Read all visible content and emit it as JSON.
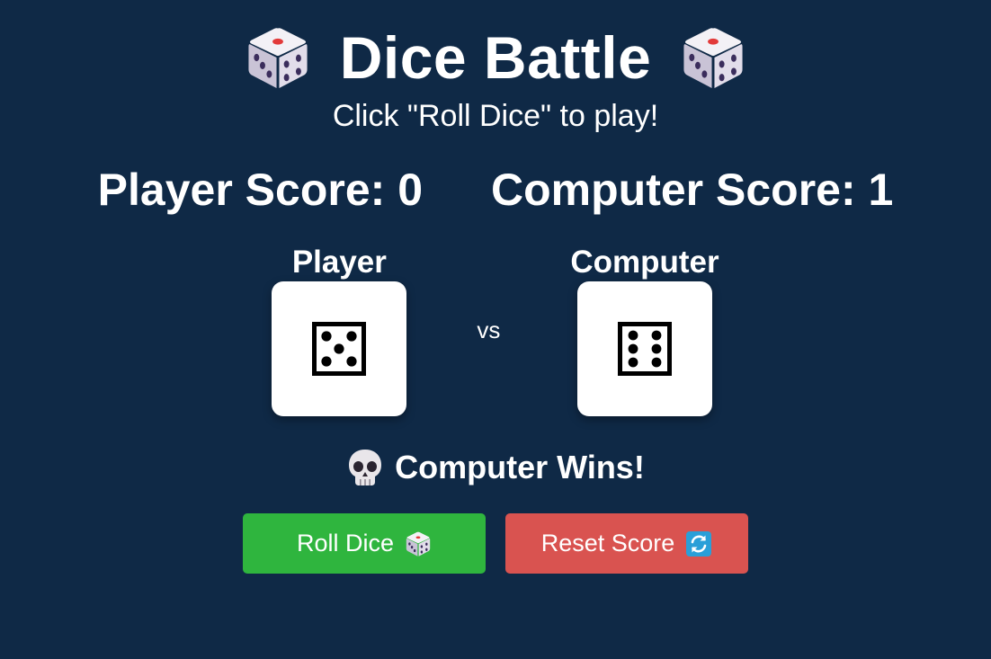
{
  "header": {
    "title": "Dice Battle",
    "subtitle": "Click \"Roll Dice\" to play!",
    "title_icon": "game-die-icon"
  },
  "scoreboard": {
    "player_label": "Player Score: 0",
    "player_score": 0,
    "computer_label": "Computer Score: 1",
    "computer_score": 1
  },
  "arena": {
    "player": {
      "label": "Player",
      "die_value": 5,
      "die_icon": "die-face-5-icon"
    },
    "vs_label": "vs",
    "computer": {
      "label": "Computer",
      "die_value": 6,
      "die_icon": "die-face-6-icon"
    }
  },
  "result": {
    "icon": "skull-icon",
    "text": "Computer Wins!"
  },
  "buttons": {
    "roll": {
      "label": "Roll Dice",
      "icon": "game-die-icon",
      "color": "#2fb53e"
    },
    "reset": {
      "label": "Reset Score",
      "icon": "refresh-icon",
      "color": "#d95350"
    }
  },
  "theme": {
    "background": "#0f2946",
    "text": "#ffffff"
  }
}
